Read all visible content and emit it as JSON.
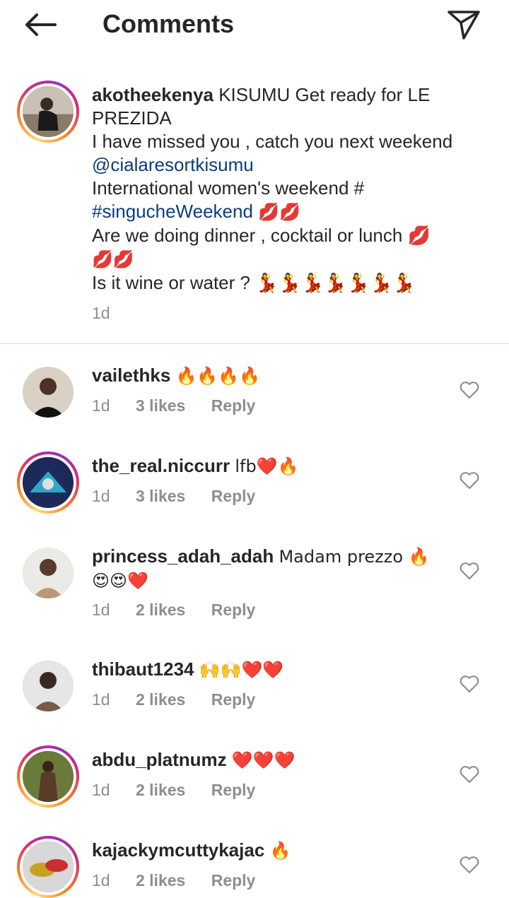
{
  "header": {
    "title": "Comments"
  },
  "caption": {
    "username": "akotheekenya",
    "lines": [
      "KISUMU Get ready for LE PREZIDA",
      "I have missed you , catch you next weekend "
    ],
    "mention": "@cialaresortkisumu",
    "line3": "International women's weekend #",
    "hashtag": "#singucheWeekend",
    "hashtag_emoji": "💋💋",
    "line4": "Are we doing dinner , cocktail or lunch 💋",
    "line5": "💋💋",
    "line6": "Is it wine or water ? 💃💃💃💃💃💃💃",
    "time": "1d"
  },
  "comments": [
    {
      "username": "vailethks",
      "text": "🔥🔥🔥🔥",
      "time": "1d",
      "likes": "3 likes",
      "reply": "Reply"
    },
    {
      "username": "the_real.niccurr",
      "text": "lfb❤️🔥",
      "time": "1d",
      "likes": "3 likes",
      "reply": "Reply"
    },
    {
      "username": "princess_adah_adah",
      "text": "Madam prezzo 🔥 😍😍❤️",
      "time": "1d",
      "likes": "2 likes",
      "reply": "Reply"
    },
    {
      "username": "thibaut1234",
      "text": "🙌🙌❤️❤️",
      "time": "1d",
      "likes": "2 likes",
      "reply": "Reply"
    },
    {
      "username": "abdu_platnumz",
      "text": "❤️❤️❤️",
      "time": "1d",
      "likes": "2 likes",
      "reply": "Reply"
    },
    {
      "username": "kajackymcuttykajac",
      "text": "🔥",
      "time": "1d",
      "likes": "2 likes",
      "reply": "Reply"
    }
  ],
  "icons": {
    "back": "arrow-left-icon",
    "send": "paper-plane-icon",
    "like": "heart-outline-icon"
  },
  "colors": {
    "link": "#0b3d7a",
    "muted": "#8e8e8e",
    "text": "#262626"
  }
}
